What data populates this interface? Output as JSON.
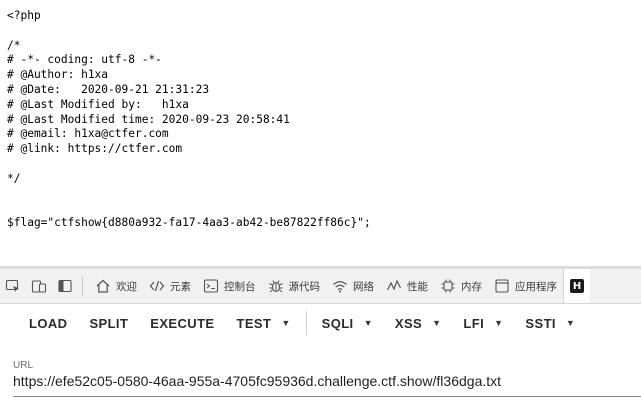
{
  "source": {
    "lines": [
      "<?php",
      "",
      "/*",
      "# -*- coding: utf-8 -*-",
      "# @Author: h1xa",
      "# @Date:   2020-09-21 21:31:23",
      "# @Last Modified by:   h1xa",
      "# @Last Modified time: 2020-09-23 20:58:41",
      "# @email: h1xa@ctfer.com",
      "# @link: https://ctfer.com",
      "",
      "*/",
      "",
      "",
      "$flag=\"ctfshow{d880a932-fa17-4aa3-ab42-be87822ff86c}\";"
    ]
  },
  "devtools": {
    "tabs": [
      {
        "label": "欢迎",
        "icon": "home-icon"
      },
      {
        "label": "元素",
        "icon": "code-icon"
      },
      {
        "label": "控制台",
        "icon": "console-icon"
      },
      {
        "label": "源代码",
        "icon": "bug-icon"
      },
      {
        "label": "网络",
        "icon": "wifi-icon"
      },
      {
        "label": "性能",
        "icon": "performance-icon"
      },
      {
        "label": "内存",
        "icon": "memory-chip-icon"
      },
      {
        "label": "应用程序",
        "icon": "application-icon"
      }
    ],
    "active_tab_badge": "H"
  },
  "hackbar": {
    "load": "LOAD",
    "split": "SPLIT",
    "execute": "EXECUTE",
    "test": "TEST",
    "sqli": "SQLI",
    "xss": "XSS",
    "lfi": "LFI",
    "ssti": "SSTI"
  },
  "url_field": {
    "label": "URL",
    "value": "https://efe52c05-0580-46aa-955a-4705fc95936d.challenge.ctf.show/fl36dga.txt"
  }
}
